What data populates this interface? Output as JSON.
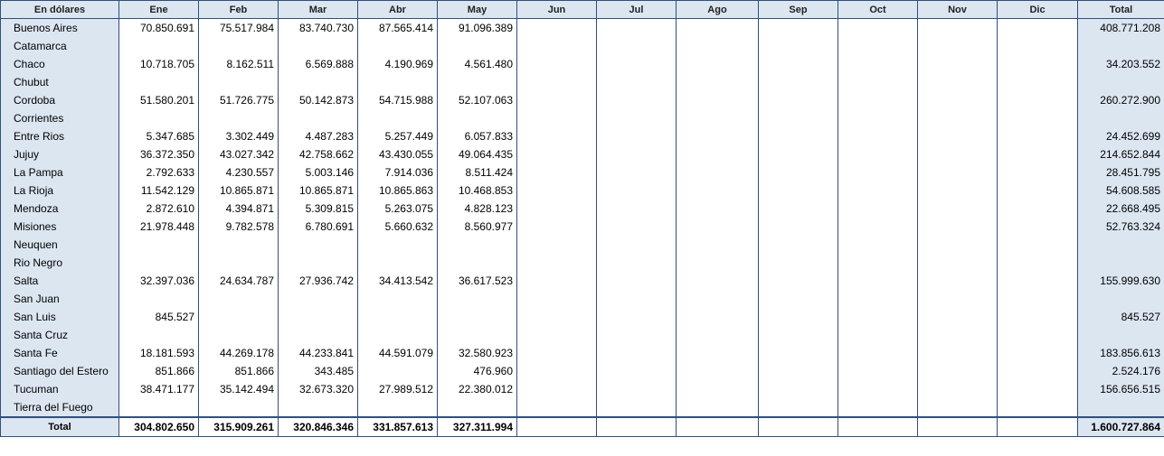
{
  "table": {
    "corner_label": "En dólares",
    "months": [
      "Ene",
      "Feb",
      "Mar",
      "Abr",
      "May",
      "Jun",
      "Jul",
      "Ago",
      "Sep",
      "Oct",
      "Nov",
      "Dic"
    ],
    "total_label": "Total",
    "rows": [
      {
        "name": "Buenos Aires",
        "values": [
          "70.850.691",
          "75.517.984",
          "83.740.730",
          "87.565.414",
          "91.096.389",
          "",
          "",
          "",
          "",
          "",
          "",
          ""
        ],
        "total": "408.771.208"
      },
      {
        "name": "Catamarca",
        "values": [
          "",
          "",
          "",
          "",
          "",
          "",
          "",
          "",
          "",
          "",
          "",
          ""
        ],
        "total": ""
      },
      {
        "name": "Chaco",
        "values": [
          "10.718.705",
          "8.162.511",
          "6.569.888",
          "4.190.969",
          "4.561.480",
          "",
          "",
          "",
          "",
          "",
          "",
          ""
        ],
        "total": "34.203.552"
      },
      {
        "name": "Chubut",
        "values": [
          "",
          "",
          "",
          "",
          "",
          "",
          "",
          "",
          "",
          "",
          "",
          ""
        ],
        "total": ""
      },
      {
        "name": "Cordoba",
        "values": [
          "51.580.201",
          "51.726.775",
          "50.142.873",
          "54.715.988",
          "52.107.063",
          "",
          "",
          "",
          "",
          "",
          "",
          ""
        ],
        "total": "260.272.900"
      },
      {
        "name": "Corrientes",
        "values": [
          "",
          "",
          "",
          "",
          "",
          "",
          "",
          "",
          "",
          "",
          "",
          ""
        ],
        "total": ""
      },
      {
        "name": "Entre Rios",
        "values": [
          "5.347.685",
          "3.302.449",
          "4.487.283",
          "5.257.449",
          "6.057.833",
          "",
          "",
          "",
          "",
          "",
          "",
          ""
        ],
        "total": "24.452.699"
      },
      {
        "name": "Jujuy",
        "values": [
          "36.372.350",
          "43.027.342",
          "42.758.662",
          "43.430.055",
          "49.064.435",
          "",
          "",
          "",
          "",
          "",
          "",
          ""
        ],
        "total": "214.652.844"
      },
      {
        "name": "La Pampa",
        "values": [
          "2.792.633",
          "4.230.557",
          "5.003.146",
          "7.914.036",
          "8.511.424",
          "",
          "",
          "",
          "",
          "",
          "",
          ""
        ],
        "total": "28.451.795"
      },
      {
        "name": "La Rioja",
        "values": [
          "11.542.129",
          "10.865.871",
          "10.865.871",
          "10.865.863",
          "10.468.853",
          "",
          "",
          "",
          "",
          "",
          "",
          ""
        ],
        "total": "54.608.585"
      },
      {
        "name": "Mendoza",
        "values": [
          "2.872.610",
          "4.394.871",
          "5.309.815",
          "5.263.075",
          "4.828.123",
          "",
          "",
          "",
          "",
          "",
          "",
          ""
        ],
        "total": "22.668.495"
      },
      {
        "name": "Misiones",
        "values": [
          "21.978.448",
          "9.782.578",
          "6.780.691",
          "5.660.632",
          "8.560.977",
          "",
          "",
          "",
          "",
          "",
          "",
          ""
        ],
        "total": "52.763.324"
      },
      {
        "name": "Neuquen",
        "values": [
          "",
          "",
          "",
          "",
          "",
          "",
          "",
          "",
          "",
          "",
          "",
          ""
        ],
        "total": ""
      },
      {
        "name": "Rio Negro",
        "values": [
          "",
          "",
          "",
          "",
          "",
          "",
          "",
          "",
          "",
          "",
          "",
          ""
        ],
        "total": ""
      },
      {
        "name": "Salta",
        "values": [
          "32.397.036",
          "24.634.787",
          "27.936.742",
          "34.413.542",
          "36.617.523",
          "",
          "",
          "",
          "",
          "",
          "",
          ""
        ],
        "total": "155.999.630"
      },
      {
        "name": "San Juan",
        "values": [
          "",
          "",
          "",
          "",
          "",
          "",
          "",
          "",
          "",
          "",
          "",
          ""
        ],
        "total": ""
      },
      {
        "name": "San Luis",
        "values": [
          "845.527",
          "",
          "",
          "",
          "",
          "",
          "",
          "",
          "",
          "",
          "",
          ""
        ],
        "total": "845.527"
      },
      {
        "name": "Santa Cruz",
        "values": [
          "",
          "",
          "",
          "",
          "",
          "",
          "",
          "",
          "",
          "",
          "",
          ""
        ],
        "total": ""
      },
      {
        "name": "Santa Fe",
        "values": [
          "18.181.593",
          "44.269.178",
          "44.233.841",
          "44.591.079",
          "32.580.923",
          "",
          "",
          "",
          "",
          "",
          "",
          ""
        ],
        "total": "183.856.613"
      },
      {
        "name": "Santiago del Estero",
        "values": [
          "851.866",
          "851.866",
          "343.485",
          "",
          "476.960",
          "",
          "",
          "",
          "",
          "",
          "",
          ""
        ],
        "total": "2.524.176"
      },
      {
        "name": "Tucuman",
        "values": [
          "38.471.177",
          "35.142.494",
          "32.673.320",
          "27.989.512",
          "22.380.012",
          "",
          "",
          "",
          "",
          "",
          "",
          ""
        ],
        "total": "156.656.515"
      },
      {
        "name": "Tierra del Fuego",
        "values": [
          "",
          "",
          "",
          "",
          "",
          "",
          "",
          "",
          "",
          "",
          "",
          ""
        ],
        "total": ""
      }
    ],
    "footer": {
      "label": "Total",
      "values": [
        "304.802.650",
        "315.909.261",
        "320.846.346",
        "331.857.613",
        "327.311.994",
        "",
        "",
        "",
        "",
        "",
        "",
        ""
      ],
      "total": "1.600.727.864"
    }
  }
}
